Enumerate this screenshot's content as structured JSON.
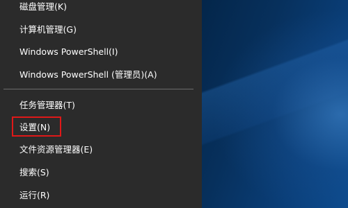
{
  "menu": {
    "items": [
      {
        "id": "disk",
        "label": "磁盘管理(K)"
      },
      {
        "id": "computer",
        "label": "计算机管理(G)"
      },
      {
        "id": "powershell",
        "label": "Windows PowerShell(I)"
      },
      {
        "id": "powershell-admin",
        "label": "Windows PowerShell (管理员)(A)"
      },
      {
        "id": "task-manager",
        "label": "任务管理器(T)"
      },
      {
        "id": "settings",
        "label": "设置(N)"
      },
      {
        "id": "explorer",
        "label": "文件资源管理器(E)"
      },
      {
        "id": "search",
        "label": "搜索(S)"
      },
      {
        "id": "run",
        "label": "运行(R)"
      }
    ]
  },
  "colors": {
    "menu_background": "#2b2b2b",
    "menu_text": "#ffffff",
    "separator": "#6e6e6e",
    "highlight_box": "#e01818",
    "desktop_background": "#0b3a6e"
  }
}
